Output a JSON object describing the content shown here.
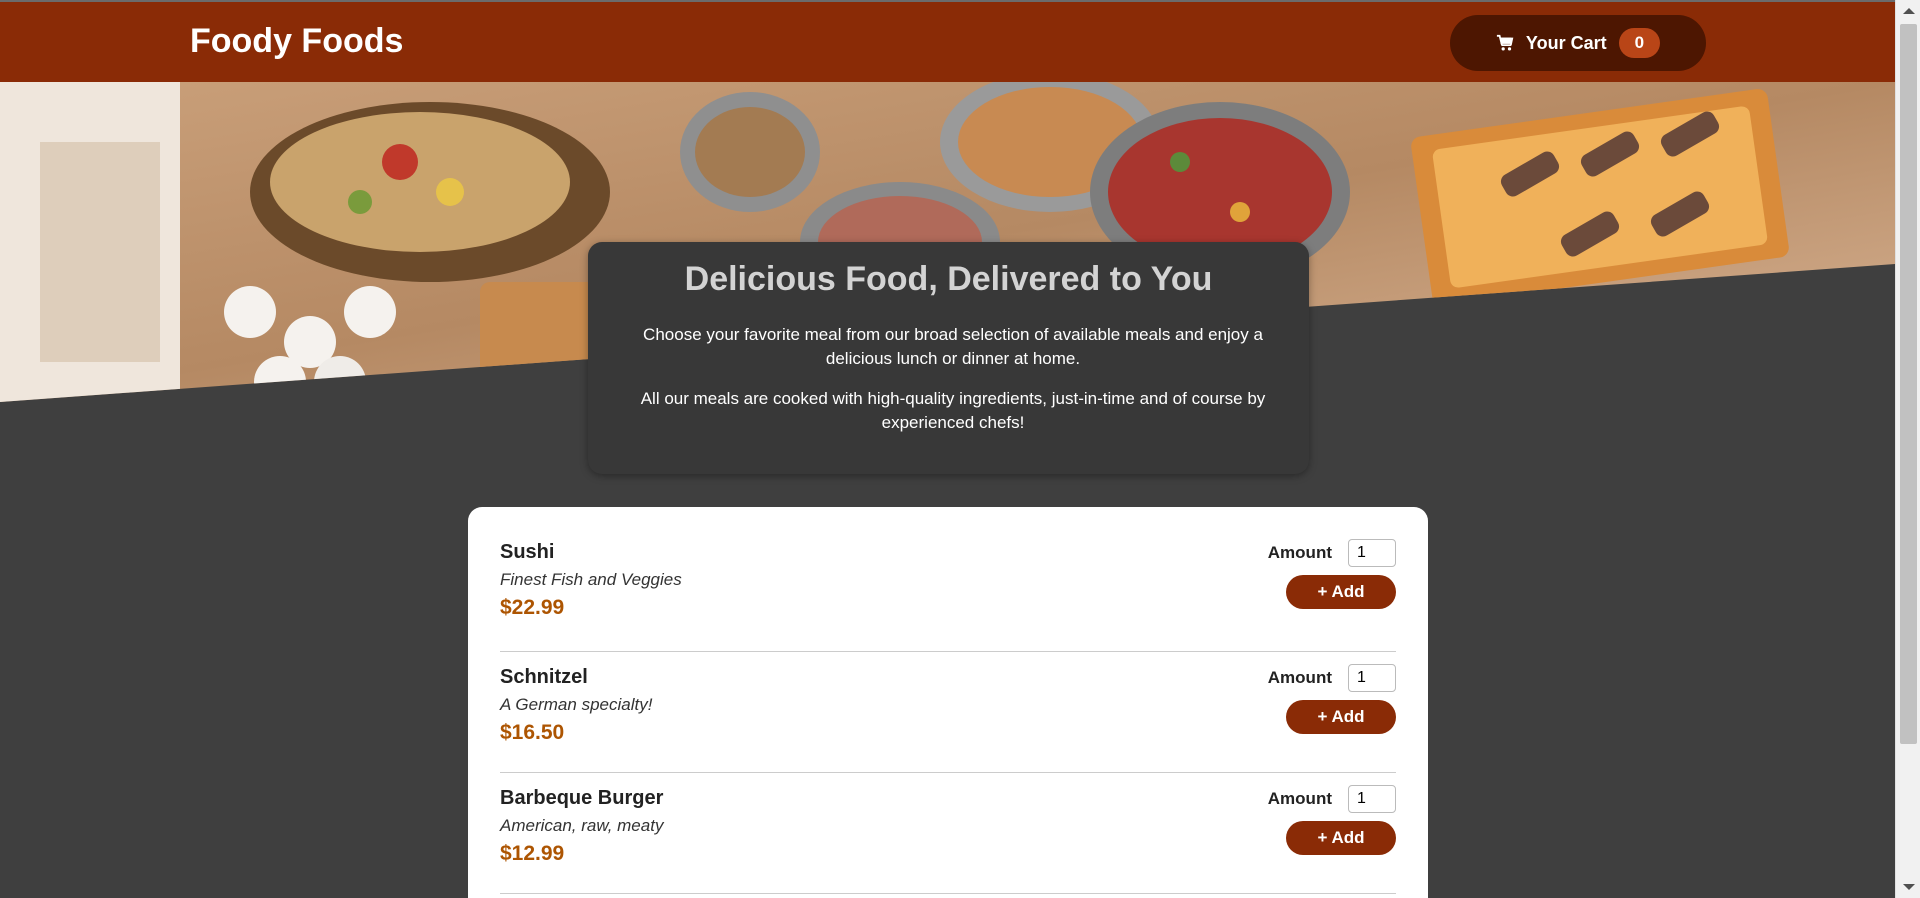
{
  "header": {
    "title": "Foody Foods",
    "cart": {
      "label": "Your Cart",
      "count": "0",
      "icon": "cart-icon"
    }
  },
  "hero": {
    "image": "buffet-table-photo"
  },
  "summary": {
    "title": "Delicious Food, Delivered to You",
    "paragraph1": "Choose your favorite meal from our broad selection of available meals and enjoy a delicious lunch or dinner at home.",
    "paragraph2": "All our meals are cooked with high-quality ingredients, just-in-time and of course by experienced chefs!"
  },
  "meals": [
    {
      "name": "Sushi",
      "description": "Finest Fish and Veggies",
      "price": "$22.99",
      "amount_label": "Amount",
      "amount": "1",
      "add_label": "+ Add"
    },
    {
      "name": "Schnitzel",
      "description": "A German specialty!",
      "price": "$16.50",
      "amount_label": "Amount",
      "amount": "1",
      "add_label": "+ Add"
    },
    {
      "name": "Barbeque Burger",
      "description": "American, raw, meaty",
      "price": "$12.99",
      "amount_label": "Amount",
      "amount": "1",
      "add_label": "+ Add"
    }
  ],
  "colors": {
    "header": "#8a2b06",
    "cart_button": "#4d1601",
    "badge": "#b94517",
    "price": "#ad5502",
    "background": "#3f3f3f"
  }
}
